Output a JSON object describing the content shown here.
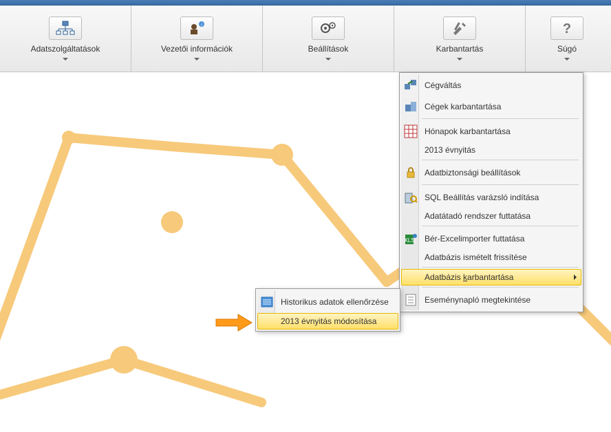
{
  "toolbar": {
    "items": [
      {
        "label": "Adatszolgáltatások",
        "icon": "org-chart-icon"
      },
      {
        "label": "Vezetői információk",
        "icon": "manager-info-icon"
      },
      {
        "label": "Beállítások",
        "icon": "settings-gears-icon"
      },
      {
        "label": "Karbantartás",
        "icon": "tools-icon"
      },
      {
        "label": "Súgó",
        "icon": "help-icon"
      }
    ]
  },
  "menu": {
    "items": [
      {
        "label": "Cégváltás",
        "icon": "company-switch-icon"
      },
      {
        "label": "Cégek karbantartása",
        "icon": "company-maint-icon"
      },
      {
        "label": "Hónapok karbantartása",
        "icon": "months-calendar-icon"
      },
      {
        "label": "2013 évnyitás",
        "icon": ""
      },
      {
        "label": "Adatbiztonsági beállítások",
        "icon": "lock-icon"
      },
      {
        "label": "SQL Beállítás varázsló indítása",
        "icon": "sql-wizard-icon"
      },
      {
        "label": "Adatátadó rendszer futtatása",
        "icon": ""
      },
      {
        "label": "Bér-Excelimporter futtatása",
        "icon": "excel-import-icon"
      },
      {
        "label": "Adatbázis ismételt frissítése",
        "icon": ""
      },
      {
        "label_pre": "Adatbázis ",
        "label_key": "k",
        "label_post": "arbantartása",
        "icon": "",
        "highlight": true
      },
      {
        "label": "Eseménynapló megtekintése",
        "icon": "eventlog-icon"
      }
    ]
  },
  "submenu": {
    "items": [
      {
        "label": "Historikus adatok ellenőrzése",
        "icon": "history-check-icon"
      },
      {
        "label": "2013 évnyitás módosítása",
        "icon": "",
        "highlight": true
      }
    ]
  },
  "chart_data": {
    "type": "line",
    "title": "",
    "xlabel": "",
    "ylabel": "",
    "x": [
      0,
      1,
      2,
      3,
      4,
      5,
      6
    ],
    "values": [
      90,
      450,
      440,
      400,
      215,
      315,
      100
    ],
    "ylim": [
      0,
      523
    ],
    "note": "values are approximate y-positions from bottom in px; no axis labels visible"
  }
}
